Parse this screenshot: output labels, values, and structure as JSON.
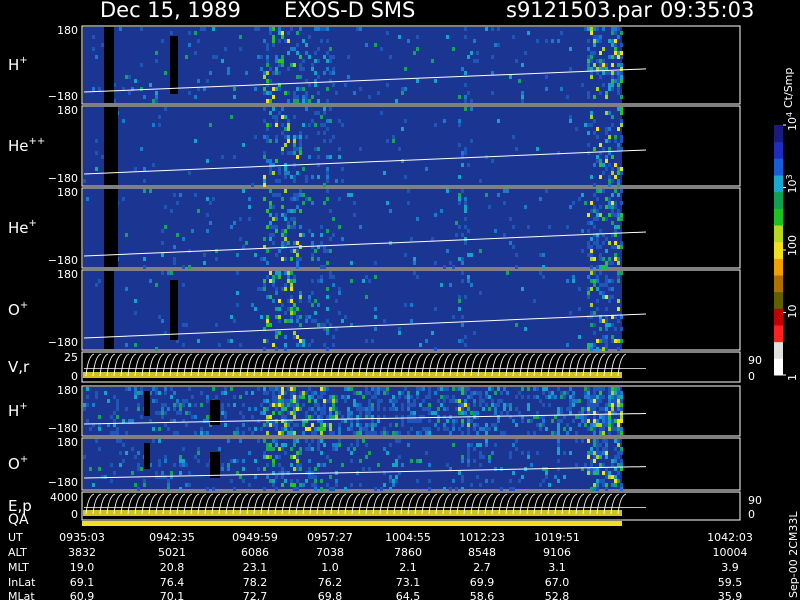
{
  "header": {
    "date": "Dec 15, 1989",
    "instrument": "EXOS-D SMS",
    "file": "s9121503.par",
    "time": "09:35:03"
  },
  "panels": [
    {
      "species": "H",
      "sup": "+",
      "top_tick": "180",
      "bottom_tick": "−180",
      "kind": "spectrogram"
    },
    {
      "species": "He",
      "sup": "++",
      "top_tick": "180",
      "bottom_tick": "−180",
      "kind": "spectrogram"
    },
    {
      "species": "He",
      "sup": "+",
      "top_tick": "180",
      "bottom_tick": "−180",
      "kind": "spectrogram"
    },
    {
      "species": "O",
      "sup": "+",
      "top_tick": "180",
      "bottom_tick": "−180",
      "kind": "spectrogram"
    },
    {
      "species": "V,r",
      "sup": "",
      "top_tick": "25",
      "bottom_tick": "0",
      "right_top": "90",
      "right_bottom": "0",
      "kind": "vector"
    },
    {
      "species": "H",
      "sup": "+",
      "top_tick": "180",
      "bottom_tick": "−180",
      "kind": "spectrogram"
    },
    {
      "species": "O",
      "sup": "+",
      "top_tick": "180",
      "bottom_tick": "−180",
      "kind": "spectrogram"
    },
    {
      "species": "E,p",
      "sup": "",
      "top_tick": "4000",
      "bottom_tick": "0",
      "right_top": "90",
      "right_bottom": "0",
      "kind": "vector"
    }
  ],
  "qa": {
    "label": "QA",
    "color": "#f0e020"
  },
  "colorbar": {
    "unit": "Ct/Smp",
    "labels": [
      {
        "base": "10",
        "sup": "4",
        "value": 10000
      },
      {
        "base": "10",
        "sup": "3",
        "value": 1000
      },
      {
        "base": "100",
        "sup": "",
        "value": 100
      },
      {
        "base": "10",
        "sup": "",
        "value": 10
      },
      {
        "base": "1",
        "sup": "",
        "value": 1
      }
    ],
    "colors": [
      "#1a1a80",
      "#1e2cc0",
      "#1a5cd8",
      "#1aa8d0",
      "#10a050",
      "#20c020",
      "#b8d820",
      "#f0e020",
      "#f0a000",
      "#b07000",
      "#606000",
      "#c00000",
      "#ff2020",
      "#e0e0e0",
      "#ffffff"
    ]
  },
  "footer": {
    "row_labels": [
      "UT",
      "ALT",
      "MLT",
      "InLat",
      "MLat"
    ],
    "columns": [
      [
        "0935:03",
        "3832",
        "19.0",
        "69.1",
        "60.9"
      ],
      [
        "0942:35",
        "5021",
        "20.8",
        "76.4",
        "70.1"
      ],
      [
        "0949:59",
        "6086",
        "23.1",
        "78.2",
        "72.7"
      ],
      [
        "0957:27",
        "7038",
        "1.0",
        "76.2",
        "69.8"
      ],
      [
        "1004:55",
        "7860",
        "2.1",
        "73.1",
        "64.5"
      ],
      [
        "1012:23",
        "8548",
        "2.7",
        "69.9",
        "58.6"
      ],
      [
        "1019:51",
        "9106",
        "3.1",
        "67.0",
        "52.8"
      ],
      [
        "1042:03",
        "10004",
        "3.9",
        "59.5",
        "35.9"
      ]
    ],
    "side_note": "Sep-00  2CM33L"
  },
  "chart_data": {
    "type": "heatmap",
    "title": "Dec 15, 1989   EXOS-D SMS",
    "x_ticks": [
      "0935:03",
      "0942:35",
      "0949:59",
      "0957:27",
      "1004:55",
      "1012:23",
      "1019:51",
      "1042:03"
    ],
    "panels": [
      "H+",
      "He++",
      "He+",
      "O+",
      "V,r",
      "H+",
      "O+",
      "E,p"
    ],
    "colorbar_unit": "Ct/Smp",
    "color_scale": "log",
    "colorbar_range": [
      1,
      10000
    ]
  }
}
